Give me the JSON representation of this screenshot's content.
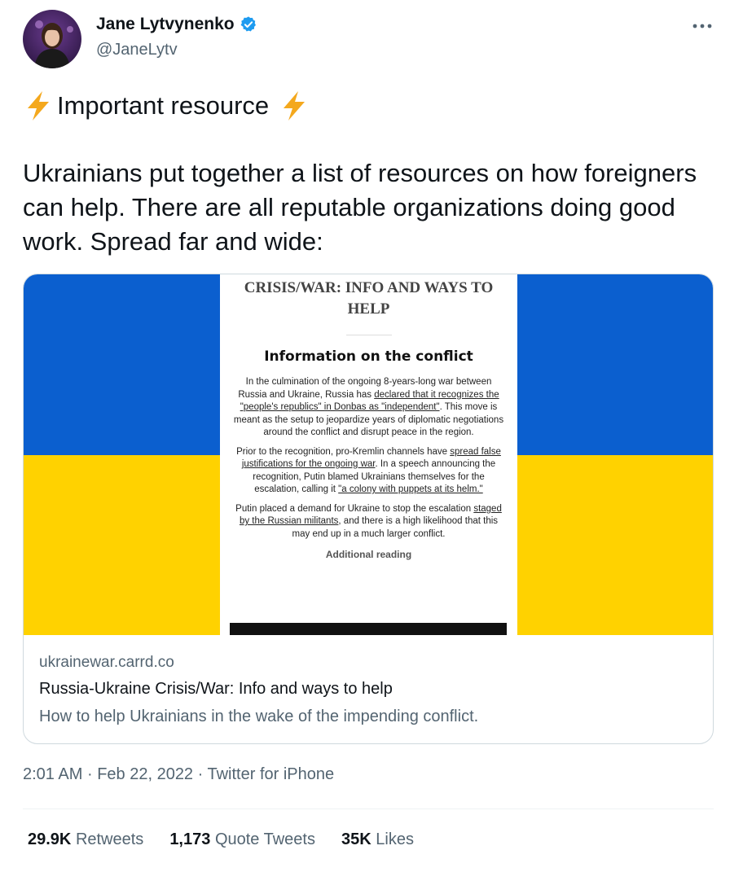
{
  "author": {
    "name": "Jane Lytvynenko",
    "handle": "@JaneLytv"
  },
  "tweet": {
    "line1": "Important resource",
    "body": "Ukrainians put together a list of resources on how foreigners can help. There are all reputable organizations doing good work. Spread far and wide:"
  },
  "card": {
    "domain": "ukrainewar.carrd.co",
    "title": "Russia-Ukraine Crisis/War: Info and ways to help",
    "description": "How to help Ukrainians in the wake of the impending conflict.",
    "preview": {
      "title": "CRISIS/WAR: INFO AND WAYS TO HELP",
      "heading": "Information on the conflict",
      "para1_a": "In the culmination of the ongoing 8-years-long war between Russia and Ukraine, Russia has ",
      "para1_link": "declared that it recognizes the \"people's republics\" in Donbas as \"independent\"",
      "para1_b": ". This move is meant as the setup to jeopardize years of diplomatic negotiations around the conflict and disrupt peace in the region.",
      "para2_a": "Prior to the recognition, pro-Kremlin channels have ",
      "para2_link1": "spread false justifications for the ongoing war",
      "para2_b": ". In a speech announcing the recognition, Putin blamed Ukrainians themselves for the escalation, calling it ",
      "para2_link2": "\"a colony with puppets at its helm.\"",
      "para3_a": "Putin placed a demand for Ukraine to stop the escalation ",
      "para3_link": "staged by the Russian militants",
      "para3_b": ", and there is a high likelihood that this may end up in a much larger conflict.",
      "subheading": "Additional reading"
    }
  },
  "meta": {
    "time": "2:01 AM",
    "separator": "·",
    "date": "Feb 22, 2022",
    "source": "Twitter for iPhone"
  },
  "stats": {
    "retweets_count": "29.9K",
    "retweets_label": "Retweets",
    "quotes_count": "1,173",
    "quotes_label": "Quote Tweets",
    "likes_count": "35K",
    "likes_label": "Likes"
  },
  "icons": {
    "verified": "verified-badge-icon",
    "bolt": "lightning-bolt-icon",
    "more": "more-horizontal-icon"
  },
  "colors": {
    "verified": "#1d9bf0",
    "bolt": "#f4a81d",
    "flag_blue": "#0b5fcf",
    "flag_yellow": "#ffd200"
  }
}
